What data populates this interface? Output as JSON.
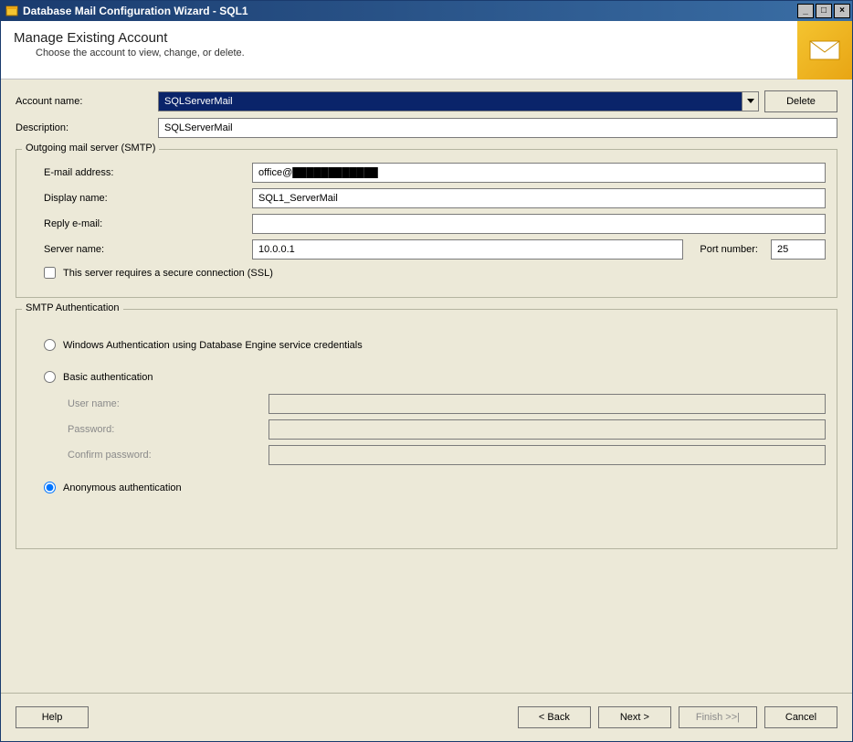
{
  "window": {
    "title": "Database Mail Configuration Wizard - SQL1"
  },
  "header": {
    "title": "Manage Existing Account",
    "subtitle": "Choose the account to view, change, or delete."
  },
  "account": {
    "name_label": "Account name:",
    "name_value": "SQLServerMail",
    "delete_label": "Delete",
    "desc_label": "Description:",
    "desc_value": "SQLServerMail"
  },
  "smtp": {
    "legend": "Outgoing mail server (SMTP)",
    "email_label": "E-mail address:",
    "email_value": "office@████████████",
    "display_label": "Display name:",
    "display_value": "SQL1_ServerMail",
    "reply_label": "Reply e-mail:",
    "reply_value": "",
    "server_label": "Server name:",
    "server_value": "10.0.0.1",
    "port_label": "Port number:",
    "port_value": "25",
    "ssl_label": "This server requires a secure connection (SSL)"
  },
  "auth": {
    "legend": "SMTP Authentication",
    "windows_label": "Windows Authentication using Database Engine service credentials",
    "basic_label": "Basic authentication",
    "user_label": "User name:",
    "user_value": "",
    "pass_label": "Password:",
    "pass_value": "",
    "confirm_label": "Confirm password:",
    "confirm_value": "",
    "anon_label": "Anonymous authentication",
    "selected": "anonymous"
  },
  "footer": {
    "help": "Help",
    "back": "< Back",
    "next": "Next >",
    "finish": "Finish >>|",
    "cancel": "Cancel"
  }
}
